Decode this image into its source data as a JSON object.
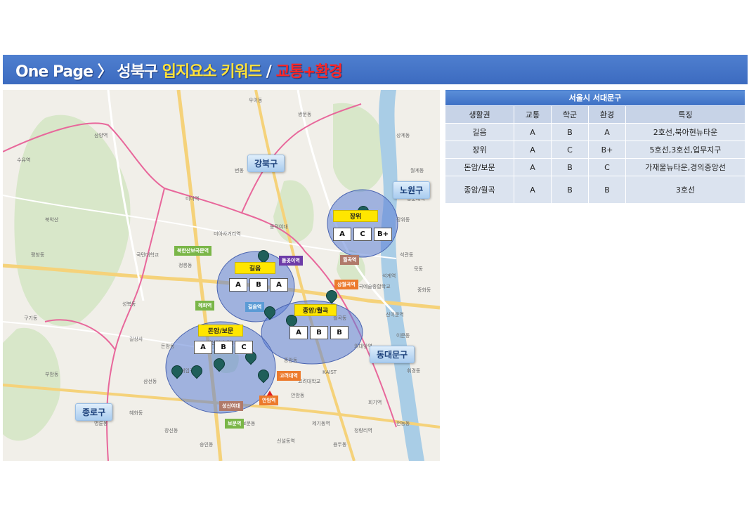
{
  "header": {
    "part1": "One Page 〉",
    "part2": "성북구",
    "part3": "입지요소 키워드",
    "part4": "/",
    "part5": "교통+환경"
  },
  "map": {
    "districts": {
      "gangbuk": "강북구",
      "nowon": "노원구",
      "dongdaemun": "동대문구",
      "jongno": "종로구"
    },
    "zones": [
      {
        "name": "길음",
        "grades": [
          "A",
          "B",
          "A"
        ]
      },
      {
        "name": "장위",
        "grades": [
          "A",
          "C",
          "B+"
        ]
      },
      {
        "name": "종암/월곡",
        "grades": [
          "A",
          "B",
          "B"
        ]
      },
      {
        "name": "돈암/보문",
        "grades": [
          "A",
          "B",
          "C"
        ]
      }
    ],
    "tags": {
      "bukhansan": "북한산보국문역",
      "hyehwa": "혜화역",
      "wolgok": "월곡역",
      "sanghwolgok": "상월곡역",
      "korea_univ": "고려대역",
      "anam": "안암역",
      "bomun": "보문역",
      "seongsin": "성신여대",
      "dolgoji": "돌곶이역",
      "gireum": "길음역"
    },
    "place_labels": [
      "수유역",
      "미아역",
      "미아사거리역",
      "삼양역",
      "국민대학교",
      "정릉동",
      "돈암동",
      "삼선동",
      "길상사",
      "북악산",
      "장위동",
      "석관동",
      "월곡동",
      "종암동",
      "안암동",
      "보문동",
      "KAIST",
      "고려대학교",
      "한국예술종합학교",
      "성신여자대학교",
      "동덕여대",
      "한성대입구역",
      "광운대역",
      "석계역",
      "신이문역",
      "외대앞역",
      "회기역",
      "청량리역",
      "제기동역",
      "신설동역",
      "상계동",
      "번동",
      "월계동",
      "중화동",
      "묵동",
      "이문동",
      "휘경동",
      "전농동",
      "용두동",
      "숭인동",
      "창신동",
      "혜화동",
      "명륜동",
      "성북동",
      "평창동",
      "구기동",
      "부암동",
      "우이동",
      "쌍문동"
    ]
  },
  "table": {
    "title": "서울시 서대문구",
    "headers": [
      "생활권",
      "교통",
      "학군",
      "환경",
      "특징"
    ],
    "rows": [
      [
        "길음",
        "A",
        "B",
        "A",
        "2호선,북아현뉴타운"
      ],
      [
        "장위",
        "A",
        "C",
        "B+",
        "5호선,3호선,업무지구"
      ],
      [
        "돈암/보문",
        "A",
        "B",
        "C",
        "가재울뉴타운,경의중앙선"
      ],
      [
        "종암/월곡",
        "A",
        "B",
        "B",
        "3호선"
      ]
    ]
  }
}
